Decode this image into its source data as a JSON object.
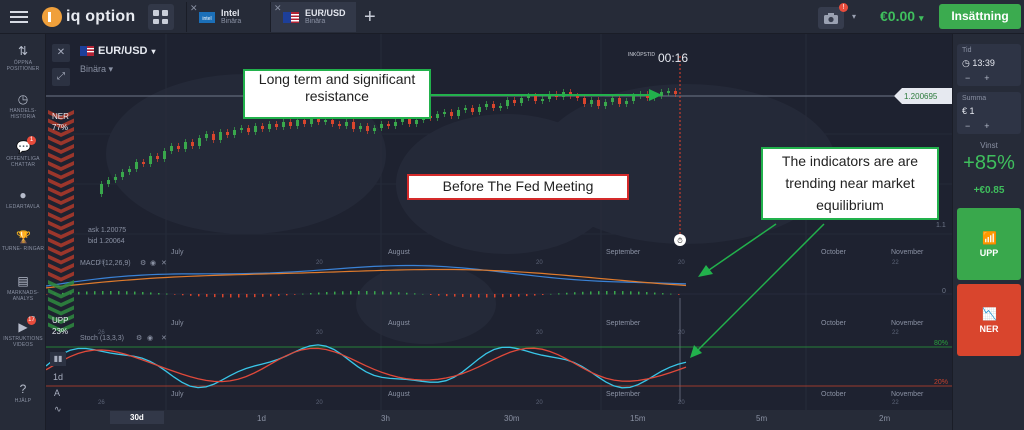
{
  "header": {
    "logo_text": "iq option",
    "tabs": [
      {
        "name": "Intel",
        "type": "Binära",
        "active": false
      },
      {
        "name": "EUR/USD",
        "type": "Binära",
        "active": true
      }
    ],
    "camera_badge": "!",
    "balance": "€0.00",
    "deposit_label": "Insättning"
  },
  "sidebar": {
    "items": [
      {
        "label": "ÖPPNA POSITIONER",
        "icon": "swap-arrows-icon"
      },
      {
        "label": "HANDELS- HISTORIA",
        "icon": "history-clock-icon"
      },
      {
        "label": "OFFENTLIGA CHATTAR",
        "icon": "chat-icon",
        "badge": "1"
      },
      {
        "label": "LEDARTAVLA",
        "icon": "leaderboard-icon"
      },
      {
        "label": "TURNE- RINGAR",
        "icon": "trophy-icon"
      },
      {
        "label": "MARKNADS- ANALYS",
        "icon": "market-analysis-icon"
      },
      {
        "label": "INSTRUKTIONS VIDEOS",
        "icon": "play-icon",
        "badge": "17"
      },
      {
        "label": "HJÄLP",
        "icon": "help-icon"
      }
    ]
  },
  "sentiment": {
    "down_label": "NER",
    "down_pct": "77%",
    "up_label": "UPP",
    "up_pct": "23%"
  },
  "chart_header": {
    "pair": "EUR/USD",
    "option_type": "Binära"
  },
  "chart": {
    "purchase_label": "INKÖPSTID",
    "countdown": "00:16",
    "price_tag": "1.200695",
    "ask": "ask 1.20075",
    "bid": "bid 1.20064",
    "scale_value": "1.1",
    "month_labels": [
      "July",
      "August",
      "September",
      "October",
      "November"
    ],
    "day_labels": [
      "26",
      "20",
      "20",
      "20",
      "22"
    ],
    "macd_label": "MACD (12,26,9)",
    "macd_zero": "0",
    "stoch_label": "Stoch (13,3,3)",
    "stoch_high": "80%",
    "stoch_low": "20%"
  },
  "annotations": {
    "resistance": "Long term and significant resistance",
    "fed": "Before The Fed Meeting",
    "indicators": "The indicators are are trending near market equilibrium"
  },
  "right_panel": {
    "time_label": "Tid",
    "time_value": "13:39",
    "amount_label": "Summa",
    "amount_value": "€ 1",
    "win_label": "Vinst",
    "win_pct": "+85%",
    "win_amount": "+€0.85",
    "up_label": "UPP",
    "down_label": "NER"
  },
  "timeframes": [
    "30d",
    "1d",
    "3h",
    "30m",
    "15m",
    "5m",
    "2m"
  ],
  "left_tools": {
    "tf_value": "1d"
  },
  "colors": {
    "up": "#39a84c",
    "down": "#d9452d",
    "macd": "#3a82d6",
    "signal": "#e07b2c",
    "stoch_k": "#39c6e8",
    "stoch_d": "#e0493a",
    "annotation_green": "#22b14c",
    "annotation_red": "#d42a2a"
  }
}
